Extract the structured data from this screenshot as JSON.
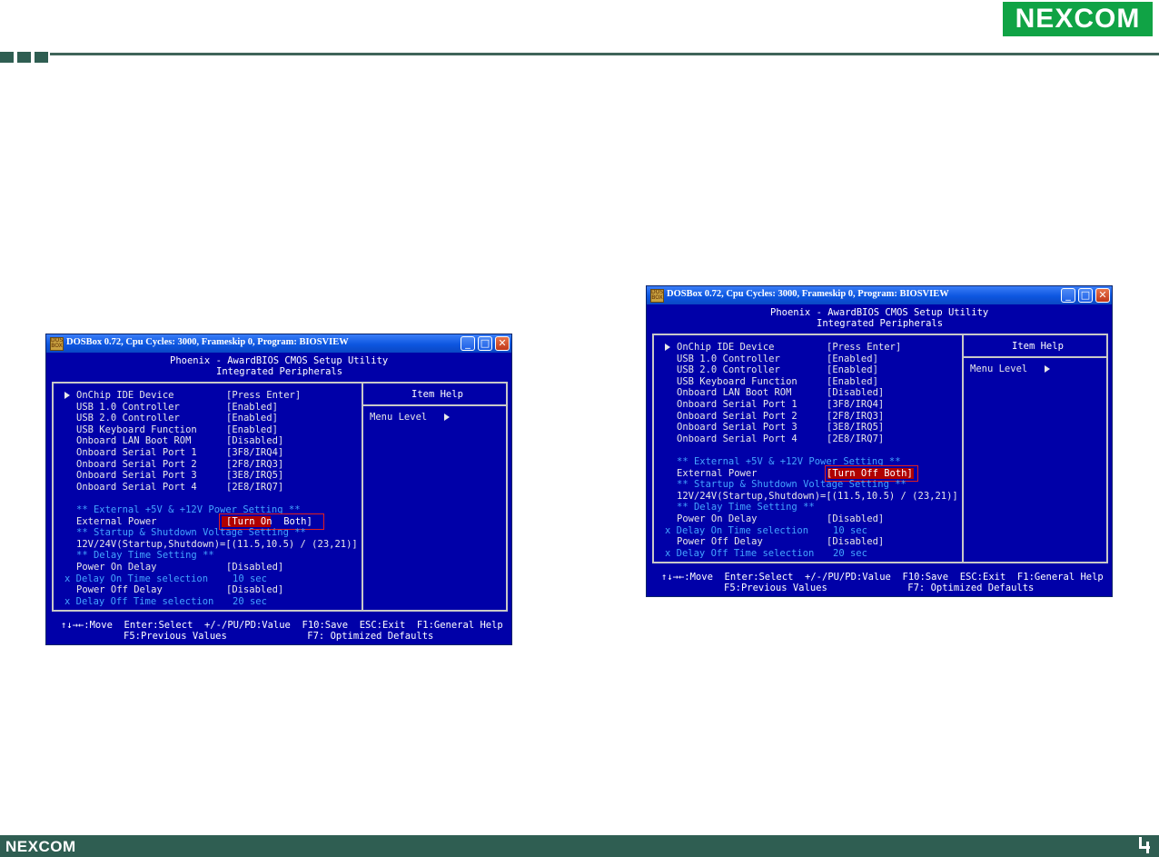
{
  "brand": {
    "name": "NEXCOM"
  },
  "windows": [
    {
      "titlebar": "DOSBox 0.72, Cpu Cycles:    3000, Frameskip  0, Program: BIOSVIEW",
      "header": [
        "Phoenix - AwardBIOS CMOS Setup Utility",
        "Integrated Peripherals"
      ],
      "items": [
        {
          "label": "OnChip IDE Device",
          "value": "[Press Enter]"
        },
        {
          "label": "USB 1.0 Controller",
          "value": "[Enabled]"
        },
        {
          "label": "USB 2.0 Controller",
          "value": "[Enabled]"
        },
        {
          "label": "USB Keyboard Function",
          "value": "[Enabled]"
        },
        {
          "label": "Onboard LAN Boot ROM",
          "value": "[Disabled]"
        },
        {
          "label": "Onboard Serial Port 1",
          "value": "[3F8/IRQ4]"
        },
        {
          "label": "Onboard Serial Port 2",
          "value": "[2F8/IRQ3]"
        },
        {
          "label": "Onboard Serial Port 3",
          "value": "[3E8/IRQ5]"
        },
        {
          "label": "Onboard Serial Port 4",
          "value": "[2E8/IRQ7]"
        }
      ],
      "ext_power_header": "** External +5V & +12V Power Setting **",
      "ext_power_label": "External Power",
      "ext_power_value": "[Turn On  Both]",
      "voltage_header": "** Startup & Shutdown Voltage Setting **",
      "voltage_line": "12V/24V(Startup,Shutdown)=[(11.5,10.5) / (23,21)]",
      "delay_header": "** Delay Time Setting **",
      "power_on_delay": {
        "label": "Power On Delay",
        "value": "[Disabled]"
      },
      "delay_on_time": {
        "label": "x Delay On Time selection",
        "value": "10 sec"
      },
      "power_off_delay": {
        "label": "Power Off Delay",
        "value": "[Disabled]"
      },
      "delay_off_time": {
        "label": "x Delay Off Time selection",
        "value": "20 sec"
      },
      "item_help": "Item Help",
      "menu_level": "Menu Level",
      "footer_line1": "↑↓→←:Move  Enter:Select  +/-/PU/PD:Value  F10:Save  ESC:Exit  F1:General Help",
      "footer_line2": "F5:Previous Values              F7: Optimized Defaults"
    },
    {
      "titlebar": "DOSBox 0.72, Cpu Cycles:    3000, Frameskip  0, Program: BIOSVIEW",
      "header": [
        "Phoenix - AwardBIOS CMOS Setup Utility",
        "Integrated Peripherals"
      ],
      "items": [
        {
          "label": "OnChip IDE Device",
          "value": "[Press Enter]"
        },
        {
          "label": "USB 1.0 Controller",
          "value": "[Enabled]"
        },
        {
          "label": "USB 2.0 Controller",
          "value": "[Enabled]"
        },
        {
          "label": "USB Keyboard Function",
          "value": "[Enabled]"
        },
        {
          "label": "Onboard LAN Boot ROM",
          "value": "[Disabled]"
        },
        {
          "label": "Onboard Serial Port 1",
          "value": "[3F8/IRQ4]"
        },
        {
          "label": "Onboard Serial Port 2",
          "value": "[2F8/IRQ3]"
        },
        {
          "label": "Onboard Serial Port 3",
          "value": "[3E8/IRQ5]"
        },
        {
          "label": "Onboard Serial Port 4",
          "value": "[2E8/IRQ7]"
        }
      ],
      "ext_power_header": "** External +5V & +12V Power Setting **",
      "ext_power_label": "External Power",
      "ext_power_value": "[Turn Off Both]",
      "voltage_header": "** Startup & Shutdown Voltage Setting **",
      "voltage_line": "12V/24V(Startup,Shutdown)=[(11.5,10.5) / (23,21)]",
      "delay_header": "** Delay Time Setting **",
      "power_on_delay": {
        "label": "Power On Delay",
        "value": "[Disabled]"
      },
      "delay_on_time": {
        "label": "x Delay On Time selection",
        "value": "10 sec"
      },
      "power_off_delay": {
        "label": "Power Off Delay",
        "value": "[Disabled]"
      },
      "delay_off_time": {
        "label": "x Delay Off Time selection",
        "value": "20 sec"
      },
      "item_help": "Item Help",
      "menu_level": "Menu Level",
      "footer_line1": "↑↓→←:Move  Enter:Select  +/-/PU/PD:Value  F10:Save  ESC:Exit  F1:General Help",
      "footer_line2": "F5:Previous Values              F7: Optimized Defaults"
    }
  ]
}
